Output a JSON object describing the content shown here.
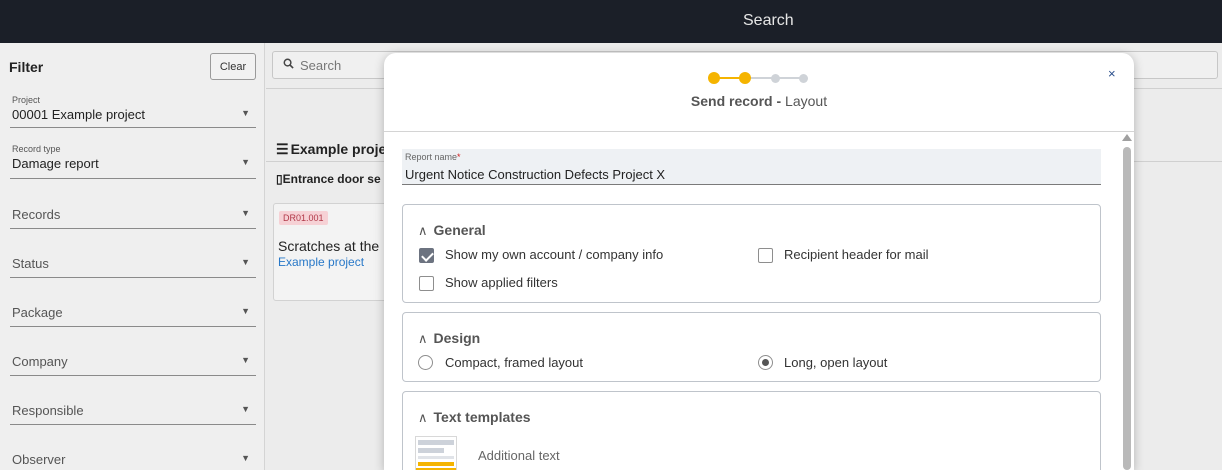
{
  "topbar": {
    "title": "Search"
  },
  "sidebar": {
    "title": "Filter",
    "clear_label": "Clear",
    "project": {
      "label": "Project",
      "value": "00001 Example project"
    },
    "record_type": {
      "label": "Record type",
      "value": "Damage report"
    },
    "filters": [
      "Records",
      "Status",
      "Package",
      "Company",
      "Responsible",
      "Observer"
    ]
  },
  "main": {
    "search_placeholder": "Search",
    "list_heading": "Example proje",
    "sub_heading": "Entrance door se",
    "card": {
      "badge": "DR01.001",
      "title": "Scratches at the",
      "project": "Example project"
    }
  },
  "modal": {
    "title_bold": "Send record -",
    "title_step": " Layout",
    "steps": {
      "total": 4,
      "completed": 2
    },
    "close_label": "×",
    "report_name": {
      "label": "Report name",
      "required_mark": "*",
      "value": "Urgent Notice Construction Defects Project X"
    },
    "general": {
      "title": "General",
      "options": [
        {
          "label": "Show my own account / company info",
          "checked": true
        },
        {
          "label": "Recipient header for mail",
          "checked": false
        },
        {
          "label": "Show applied filters",
          "checked": false
        }
      ]
    },
    "design": {
      "title": "Design",
      "options": [
        {
          "label": "Compact, framed layout",
          "selected": false
        },
        {
          "label": "Long, open layout",
          "selected": true
        }
      ]
    },
    "text_templates": {
      "title": "Text templates",
      "items": [
        {
          "label": "Additional text"
        }
      ]
    }
  },
  "colors": {
    "accent": "#f5b400",
    "topbar": "#1b1f28",
    "link": "#2878c8",
    "badge_bg": "#f6d1d5",
    "badge_text": "#b03848"
  },
  "icons": {
    "search": "search-icon",
    "list": "list-icon",
    "clipboard": "clipboard-icon",
    "close": "close-icon",
    "chevron": "chevron-up-icon"
  }
}
